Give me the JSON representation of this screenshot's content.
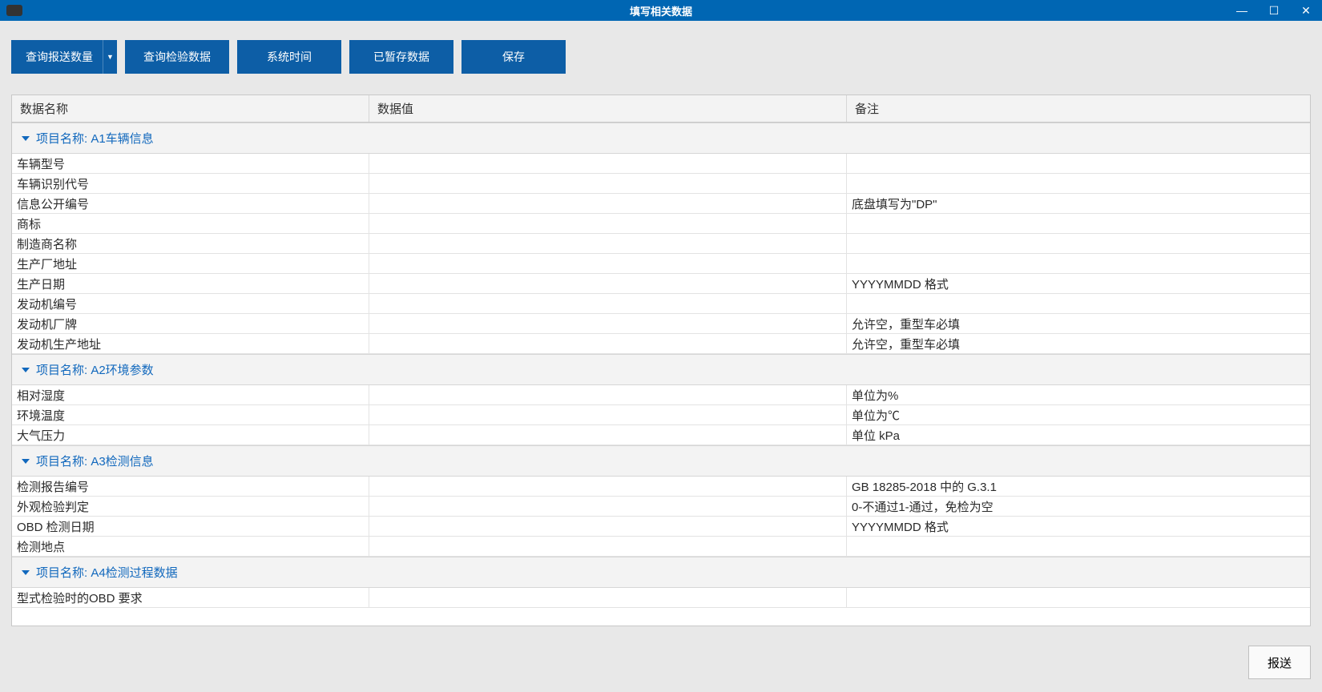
{
  "window": {
    "title": "填写相关数据"
  },
  "toolbar": {
    "query_send_count": "查询报送数量",
    "query_inspect_data": "查询检验数据",
    "system_time": "系统时间",
    "temp_saved_data": "已暂存数据",
    "save": "保存"
  },
  "columns": {
    "name": "数据名称",
    "value": "数据值",
    "remark": "备注"
  },
  "group_label_prefix": "项目名称: ",
  "groups": [
    {
      "id": "A1",
      "title": "A1车辆信息",
      "rows": [
        {
          "name": "车辆型号",
          "value": "",
          "remark": ""
        },
        {
          "name": "车辆识别代号",
          "value": "",
          "remark": ""
        },
        {
          "name": "信息公开编号",
          "value": "",
          "remark": "底盘填写为\"DP\""
        },
        {
          "name": "商标",
          "value": "",
          "remark": ""
        },
        {
          "name": "制造商名称",
          "value": "",
          "remark": ""
        },
        {
          "name": "生产厂地址",
          "value": "",
          "remark": ""
        },
        {
          "name": "生产日期",
          "value": "",
          "remark": "YYYYMMDD 格式"
        },
        {
          "name": "发动机编号",
          "value": "",
          "remark": ""
        },
        {
          "name": "发动机厂牌",
          "value": "",
          "remark": "允许空，重型车必填"
        },
        {
          "name": "发动机生产地址",
          "value": "",
          "remark": "允许空，重型车必填"
        }
      ]
    },
    {
      "id": "A2",
      "title": "A2环境参数",
      "rows": [
        {
          "name": "相对湿度",
          "value": "",
          "remark": "单位为%"
        },
        {
          "name": "环境温度",
          "value": "",
          "remark": "单位为℃"
        },
        {
          "name": "大气压力",
          "value": "",
          "remark": "单位 kPa"
        }
      ]
    },
    {
      "id": "A3",
      "title": "A3检测信息",
      "rows": [
        {
          "name": "检测报告编号",
          "value": "",
          "remark": "GB 18285-2018 中的 G.3.1"
        },
        {
          "name": "外观检验判定",
          "value": "",
          "remark": "0-不通过1-通过，免检为空"
        },
        {
          "name": "OBD 检测日期",
          "value": "",
          "remark": "YYYYMMDD 格式"
        },
        {
          "name": "检测地点",
          "value": "",
          "remark": ""
        }
      ]
    },
    {
      "id": "A4",
      "title": "A4检测过程数据",
      "rows": [
        {
          "name": "型式检验时的OBD 要求",
          "value": "",
          "remark": ""
        }
      ]
    }
  ],
  "footer": {
    "submit": "报送"
  }
}
